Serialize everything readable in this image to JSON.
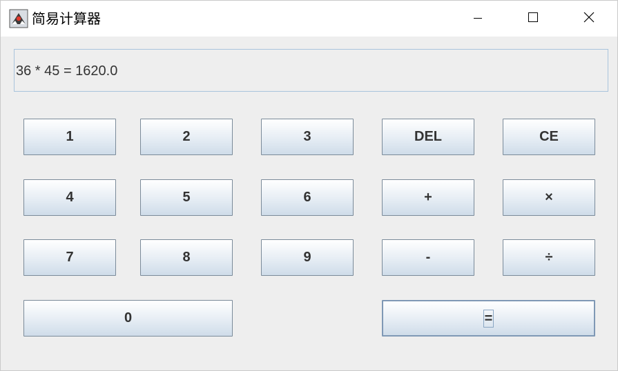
{
  "window": {
    "title": "简易计算器",
    "controls": {
      "minimize": "minimize",
      "maximize": "maximize",
      "close": "close"
    }
  },
  "display": {
    "value": "36 * 45 = 1620.0"
  },
  "keypad": {
    "k1": "1",
    "k2": "2",
    "k3": "3",
    "del": "DEL",
    "ce": "CE",
    "k4": "4",
    "k5": "5",
    "k6": "6",
    "plus": "+",
    "times": "×",
    "k7": "7",
    "k8": "8",
    "k9": "9",
    "minus": "-",
    "divide": "÷",
    "k0": "0",
    "equals": "="
  },
  "colors": {
    "titlebar_bg": "#ffffff",
    "window_bg": "#eeeeee",
    "display_border": "#a9c3dc",
    "button_border": "#7a8a99",
    "button_text": "#333333"
  },
  "icons": {
    "app": "java-duke-icon",
    "minimize": "minimize-icon",
    "maximize": "maximize-icon",
    "close": "close-icon"
  }
}
